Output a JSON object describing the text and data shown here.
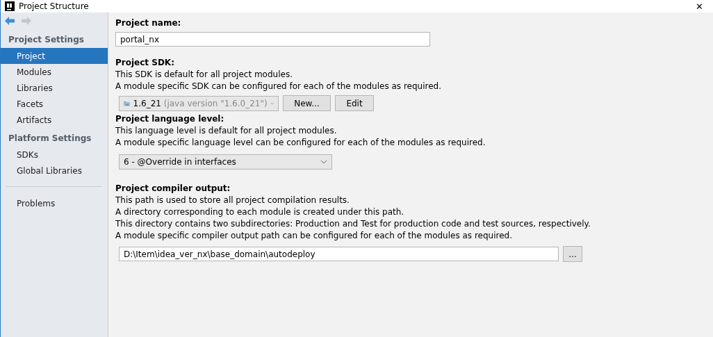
{
  "window": {
    "title": "Project Structure",
    "close": "✕"
  },
  "sidebar": {
    "groups": [
      {
        "title": "Project Settings",
        "items": [
          {
            "label": "Project",
            "selected": true
          },
          {
            "label": "Modules",
            "selected": false
          },
          {
            "label": "Libraries",
            "selected": false
          },
          {
            "label": "Facets",
            "selected": false
          },
          {
            "label": "Artifacts",
            "selected": false
          }
        ]
      },
      {
        "title": "Platform Settings",
        "items": [
          {
            "label": "SDKs",
            "selected": false
          },
          {
            "label": "Global Libraries",
            "selected": false
          }
        ]
      }
    ],
    "bottom_items": [
      {
        "label": "Problems",
        "selected": false
      }
    ]
  },
  "project_name": {
    "label": "Project name:",
    "value": "portal_nx"
  },
  "project_sdk": {
    "label": "Project SDK:",
    "lines": [
      "This SDK is default for all project modules.",
      "A module specific SDK can be configured for each of the modules as required."
    ],
    "sdk_name": "1.6_21",
    "sdk_version": "(java version \"1.6.0_21\")",
    "buttons": [
      "New...",
      "Edit"
    ]
  },
  "language_level": {
    "label": "Project language level:",
    "lines": [
      "This language level is default for all project modules.",
      "A module specific language level can be configured for each of the modules as required."
    ],
    "value": "6 - @Override in interfaces"
  },
  "compiler_output": {
    "label": "Project compiler output:",
    "lines": [
      "This path is used to store all project compilation results.",
      "A directory corresponding to each module is created under this path.",
      "This directory contains two subdirectories: Production and Test for production code and test sources, respectively.",
      "A module specific compiler output path can be configured for each of the modules as required."
    ],
    "value": "D:\\Item\\idea_ver_nx\\base_domain\\autodeploy",
    "browse": "..."
  }
}
